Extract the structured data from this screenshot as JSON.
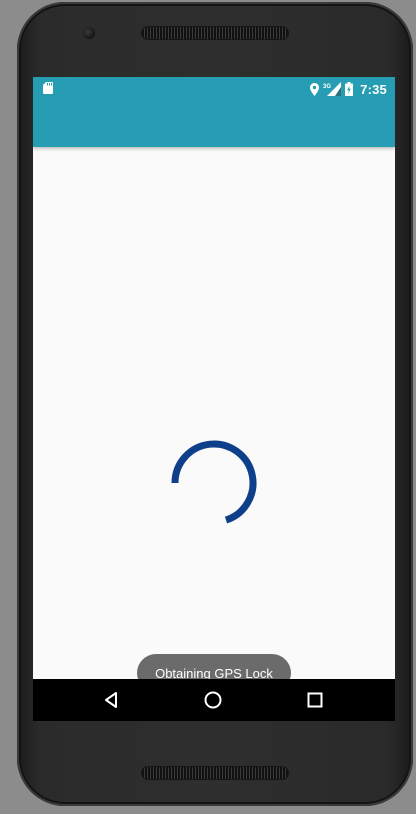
{
  "status_bar": {
    "time": "7:35",
    "network_type": "3G",
    "icons": [
      "sd-card-icon",
      "location-icon",
      "signal-icon",
      "battery-icon"
    ],
    "background_color": "#269db2"
  },
  "app_bar": {
    "background_color": "#269db2"
  },
  "content": {
    "spinner_color": "#0d3f8a",
    "toast": {
      "text": "Obtaining GPS Lock"
    }
  },
  "nav_bar": {
    "buttons": [
      "back-icon",
      "home-icon",
      "recents-icon"
    ]
  }
}
